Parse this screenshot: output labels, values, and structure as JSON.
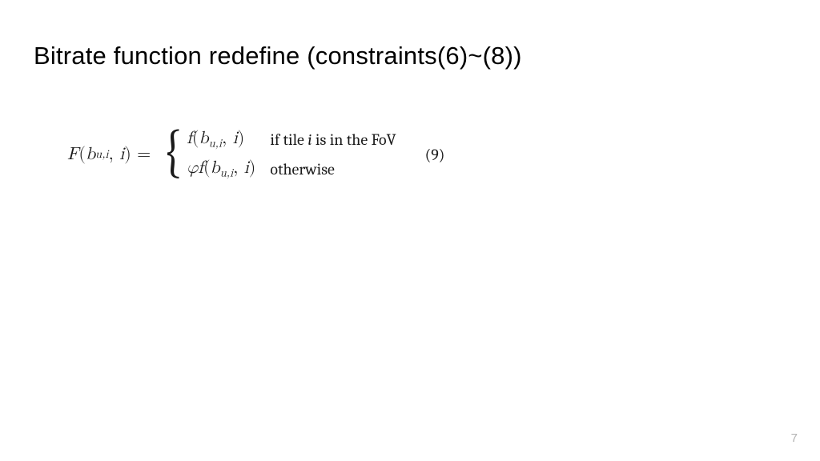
{
  "title": "Bitrate function redefine (constraints(6)~(8))",
  "equation": {
    "lhs_func": "F",
    "inner_func": "f",
    "arg_var": "b",
    "arg_sub": "u,i",
    "second_arg": "i",
    "coeff_sym": "φ",
    "cond1_pre": "if tile ",
    "cond1_var": "i",
    "cond1_post": " is in the FoV",
    "cond2": "otherwise",
    "number": "(9)"
  },
  "chart_data": {
    "type": "table",
    "note": "Piecewise definition of bitrate function F(b_{u,i}, i)",
    "rows": [
      {
        "expression": "f(b_{u,i}, i)",
        "condition": "if tile i is in the FoV"
      },
      {
        "expression": "φ f(b_{u,i}, i)",
        "condition": "otherwise"
      }
    ],
    "equation_number": 9
  },
  "page_number": "7"
}
